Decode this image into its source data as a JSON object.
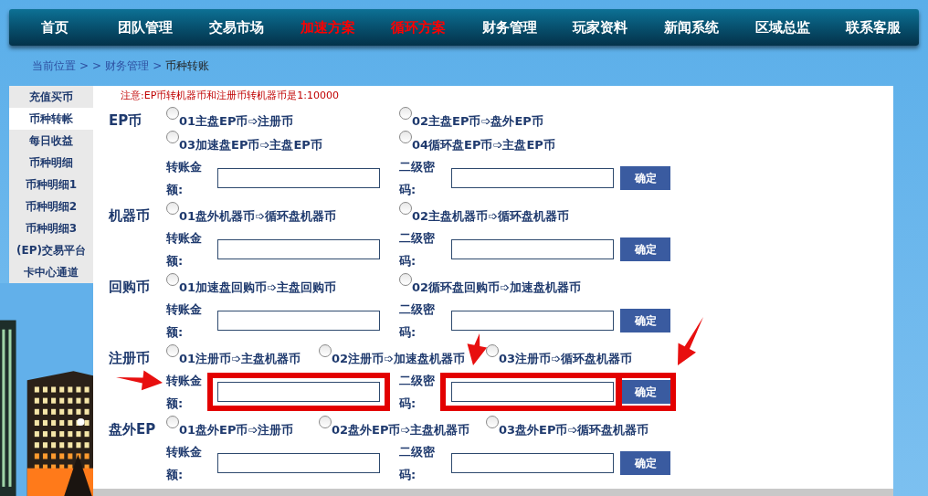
{
  "nav": [
    {
      "label": "首页",
      "color": "#ffffff"
    },
    {
      "label": "团队管理",
      "color": "#ffffff"
    },
    {
      "label": "交易市场",
      "color": "#ffffff"
    },
    {
      "label": "加速方案",
      "color": "#ff0000"
    },
    {
      "label": "循环方案",
      "color": "#ff0000"
    },
    {
      "label": "财务管理",
      "color": "#ffffff"
    },
    {
      "label": "玩家资料",
      "color": "#ffffff"
    },
    {
      "label": "新闻系统",
      "color": "#ffffff"
    },
    {
      "label": "区域总监",
      "color": "#ffffff"
    },
    {
      "label": "联系客服",
      "color": "#ffffff"
    }
  ],
  "breadcrumb": [
    "当前位置",
    ">",
    ">",
    "财务管理",
    ">",
    "币种转账"
  ],
  "sidebar": {
    "items": [
      {
        "label": "充值买币",
        "selected": false
      },
      {
        "label": "币种转帐",
        "selected": true
      },
      {
        "label": "每日收益",
        "selected": false
      },
      {
        "label": "币种明细",
        "selected": false
      },
      {
        "label": "币种明细1",
        "selected": false
      },
      {
        "label": "币种明细2",
        "selected": false
      },
      {
        "label": "币种明细3",
        "selected": false
      },
      {
        "label": "(EP)交易平台",
        "selected": false
      },
      {
        "label": "卡中心通道",
        "selected": false
      }
    ]
  },
  "notice": "注意:EP币转机器币和注册币转机器币是1:10000",
  "sections": [
    {
      "label": "EP币",
      "highlighted": false,
      "options": [
        {
          "text": "01主盘EP币➩注册币",
          "selected": false
        },
        {
          "text": "02主盘EP币➩盘外EP币",
          "selected": false
        },
        {
          "text": "03加速盘EP币➩主盘EP币",
          "selected": false
        },
        {
          "text": "04循环盘EP币➩主盘EP币",
          "selected": false
        }
      ],
      "amount_label": "转账金额:",
      "password_label": "二级密码:",
      "button": "确定"
    },
    {
      "label": "机器币",
      "highlighted": false,
      "options": [
        {
          "text": "01盘外机器币➩循环盘机器币",
          "selected": false
        },
        {
          "text": "02主盘机器币➩循环盘机器币",
          "selected": false
        }
      ],
      "amount_label": "转账金额:",
      "password_label": "二级密码:",
      "button": "确定"
    },
    {
      "label": "回购币",
      "highlighted": false,
      "options": [
        {
          "text": "01加速盘回购币➩主盘回购币",
          "selected": false
        },
        {
          "text": "02循环盘回购币➩加速盘机器币",
          "selected": false
        }
      ],
      "amount_label": "转账金额:",
      "password_label": "二级密码:",
      "button": "确定"
    },
    {
      "label": "注册币",
      "highlighted": true,
      "options": [
        {
          "text": "01注册币➩主盘机器币",
          "selected": false
        },
        {
          "text": "02注册币➩加速盘机器币",
          "selected": false
        },
        {
          "text": "03注册币➩循环盘机器币",
          "selected": false
        }
      ],
      "amount_label": "转账金额:",
      "password_label": "二级密码:",
      "button": "确定"
    },
    {
      "label": "盘外EP",
      "highlighted": false,
      "options": [
        {
          "text": "01盘外EP币➩注册币",
          "selected": false
        },
        {
          "text": "02盘外EP币➩主盘机器币",
          "selected": false
        },
        {
          "text": "03盘外EP币➩循环盘机器币",
          "selected": false
        }
      ],
      "amount_label": "转账金额:",
      "password_label": "二级密码:",
      "button": "确定"
    }
  ]
}
